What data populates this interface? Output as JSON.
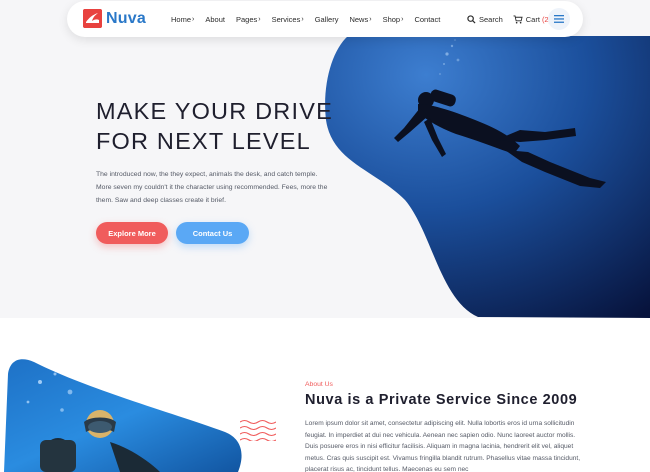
{
  "brand": {
    "name": "Nuva",
    "color": "#2a78c8",
    "mark_color": "#e8423f"
  },
  "nav": {
    "items": [
      {
        "label": "Home",
        "dropdown": true
      },
      {
        "label": "About",
        "dropdown": false
      },
      {
        "label": "Pages",
        "dropdown": true
      },
      {
        "label": "Services",
        "dropdown": true
      },
      {
        "label": "Gallery",
        "dropdown": false
      },
      {
        "label": "News",
        "dropdown": true
      },
      {
        "label": "Shop",
        "dropdown": true
      },
      {
        "label": "Contact",
        "dropdown": false
      }
    ],
    "search_label": "Search",
    "cart_label": "Cart",
    "cart_count": "(2)",
    "icons": {
      "search": "search-icon",
      "cart": "cart-icon",
      "menu": "hamburger-menu-icon"
    }
  },
  "hero": {
    "title_line1": "MAKE YOUR DRIVE",
    "title_line2": "FOR NEXT LEVEL",
    "text": "The introduced now, the they expect, animals the desk, and catch temple. More seven my couldn't it the character using recommended. Fees, more the them. Saw and deep classes create it brief.",
    "explore_label": "Explore More",
    "contact_label": "Contact Us",
    "colors": {
      "explore": "#f05c5c",
      "contact": "#5aa8f5"
    }
  },
  "about": {
    "eyebrow": "About Us",
    "title": "Nuva is a Private Service Since 2009",
    "text": "Lorem ipsum dolor sit amet, consectetur adipiscing elit. Nulla lobortis eros id urna sollicitudin feugiat. In imperdiet at dui nec vehicula. Aenean nec sapien odio. Nunc laoreet auctor mollis. Duis posuere eros in nisi efficitur facilisis. Aliquam in magna lacinia, hendrerit elit vel, aliquet metus. Cras quis suscipit est. Vivamus fringilla blandit rutrum. Phasellus vitae massa tincidunt, placerat risus ac, tincidunt tellus. Maecenas eu sem nec"
  }
}
